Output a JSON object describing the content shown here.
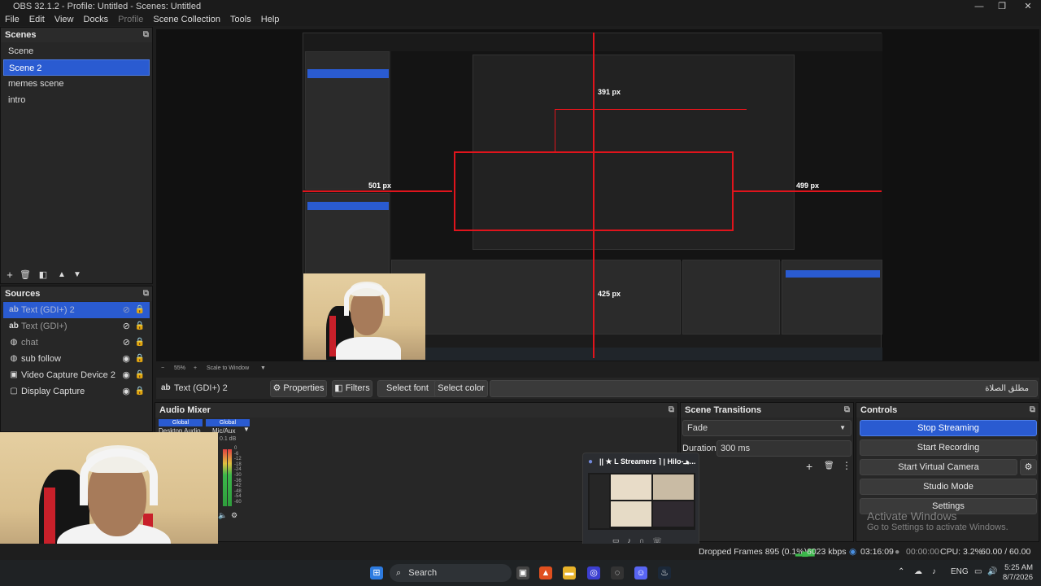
{
  "window": {
    "title": "OBS 32.1.2 - Profile: Untitled - Scenes: Untitled",
    "minimize": "—",
    "maximize": "❐",
    "close": "✕"
  },
  "menu": [
    "File",
    "Edit",
    "View",
    "Docks",
    "Profile",
    "Scene Collection",
    "Tools",
    "Help"
  ],
  "scenes": {
    "title": "Scenes",
    "items": [
      "Scene",
      "Scene 2",
      "memes scene",
      "intro"
    ],
    "selected": 1
  },
  "sources": {
    "title": "Sources",
    "items": [
      {
        "name": "Text (GDI+) 2",
        "icon": "ab",
        "visible": false
      },
      {
        "name": "Text (GDI+)",
        "icon": "ab",
        "visible": false
      },
      {
        "name": "chat",
        "icon": "globe",
        "visible": false
      },
      {
        "name": "sub follow",
        "icon": "globe",
        "visible": true
      },
      {
        "name": "Video Capture Device 2",
        "icon": "camera",
        "visible": true
      },
      {
        "name": "Display Capture",
        "icon": "monitor",
        "visible": true
      }
    ],
    "selected": 0
  },
  "preview": {
    "measures": [
      "391 px",
      "501 px",
      "499 px",
      "425 px"
    ],
    "zoom": "55%",
    "scale_mode": "Scale to Window"
  },
  "properties_bar": {
    "source_name": "Text (GDI+) 2",
    "properties": "Properties",
    "filters": "Filters",
    "select_font": "Select font",
    "select_color": "Select color",
    "text_preview": "مطلق الصلاة"
  },
  "audio_mixer": {
    "title": "Audio Mixer",
    "tracks": [
      "Global",
      "Global"
    ],
    "channels": [
      "Desktop Audio",
      "Mic/Aux"
    ],
    "db": "0.1 dB",
    "scale": [
      "0",
      "-6",
      "-12",
      "-18",
      "-24",
      "-30",
      "-36",
      "-42",
      "-48",
      "-54",
      "-60"
    ]
  },
  "scene_transitions": {
    "title": "Scene Transitions",
    "transition": "Fade",
    "duration_label": "Duration",
    "duration": "300 ms"
  },
  "controls": {
    "title": "Controls",
    "stop_streaming": "Stop Streaming",
    "start_recording": "Start Recording",
    "start_virtual_camera": "Start Virtual Camera",
    "studio_mode": "Studio Mode",
    "settings": "Settings"
  },
  "watermark": {
    "title": "Activate Windows",
    "subtitle": "Go to Settings to activate Windows."
  },
  "discord_popup": {
    "title": "|| ★ L Streamers ⌉ | Hilo-هـ..."
  },
  "status": {
    "dropped": "Dropped Frames 895 (0.1%)",
    "bitrate": "6023 kbps",
    "stream_time": "03:16:09",
    "rec_time": "00:00:00",
    "cpu": "CPU: 3.2%",
    "fps": "60.00 / 60.00 FPS"
  },
  "taskbar": {
    "search": "Search",
    "lang": "ENG",
    "time": "5:25 AM",
    "date": "8/7/2026"
  },
  "colors": {
    "accent": "#2a5bd1",
    "red_guide": "#e0141c",
    "bg": "#1e1e1e",
    "panel": "#272727"
  }
}
